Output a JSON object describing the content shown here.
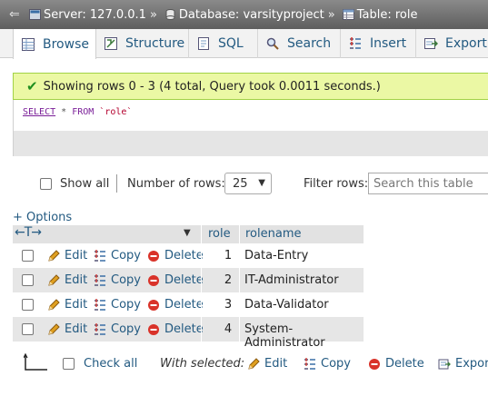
{
  "breadcrumb": {
    "server": "Server: 127.0.0.1",
    "database": "Database: varsityproject",
    "table": "Table: role",
    "separator": "»"
  },
  "tabs": [
    {
      "label": "Browse",
      "icon": "browse-icon",
      "active": true
    },
    {
      "label": "Structure",
      "icon": "structure-icon",
      "active": false
    },
    {
      "label": "SQL",
      "icon": "sql-icon",
      "active": false
    },
    {
      "label": "Search",
      "icon": "search-icon",
      "active": false
    },
    {
      "label": "Insert",
      "icon": "insert-icon",
      "active": false
    },
    {
      "label": "Export",
      "icon": "export-icon",
      "active": false
    }
  ],
  "message": {
    "text": "Showing rows 0 - 3 (4 total, Query took 0.0011 seconds.)",
    "color": "#ebf8a4"
  },
  "sql": {
    "select": "SELECT",
    "star": " * ",
    "from": "FROM",
    "table": " `role`"
  },
  "nav": {
    "show_all": "Show all",
    "number_of_rows_label": "Number of rows:",
    "rows_value": "25",
    "filter_label": "Filter rows:",
    "filter_placeholder": "Search this table"
  },
  "options_link": "+ Options",
  "table": {
    "arrows": "←T→",
    "columns": [
      "role",
      "rolename"
    ],
    "actions": {
      "edit": "Edit",
      "copy": "Copy",
      "delete": "Delete"
    },
    "rows": [
      {
        "role": "1",
        "rolename": "Data-Entry"
      },
      {
        "role": "2",
        "rolename": "IT-Administrator"
      },
      {
        "role": "3",
        "rolename": "Data-Validator"
      },
      {
        "role": "4",
        "rolename": "System-Administrator"
      }
    ]
  },
  "bottom": {
    "check_all": "Check all",
    "with_selected": "With selected:",
    "edit": "Edit",
    "copy": "Copy",
    "delete": "Delete",
    "export": "Export"
  },
  "colors": {
    "link": "#235a81",
    "delete": "#d9332a",
    "pencil": "#e0a020"
  }
}
